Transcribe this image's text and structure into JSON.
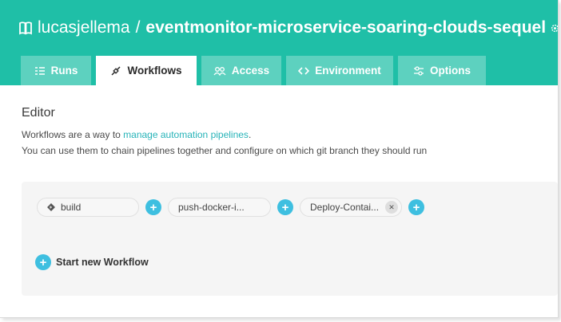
{
  "repo": {
    "owner": "lucasjellema",
    "separator": "/",
    "name": "eventmonitor-microservice-soaring-clouds-sequel"
  },
  "tabs": [
    {
      "label": "Runs",
      "icon": "runs-icon"
    },
    {
      "label": "Workflows",
      "icon": "workflow-icon"
    },
    {
      "label": "Access",
      "icon": "access-icon"
    },
    {
      "label": "Environment",
      "icon": "code-icon"
    },
    {
      "label": "Options",
      "icon": "options-icon"
    }
  ],
  "active_tab": "Workflows",
  "editor": {
    "title": "Editor",
    "desc_prefix": "Workflows are a way to ",
    "desc_link": "manage automation pipelines",
    "desc_suffix": ".",
    "desc_line2": "You can use them to chain pipelines together and configure on which git branch they should run"
  },
  "workflow": {
    "pipelines": [
      "build",
      "push-docker-i...",
      "Deploy-Contai..."
    ],
    "start_label": "Start new Workflow"
  },
  "colors": {
    "header": "#1fbfa7",
    "tab_inactive": "#5dd1bf",
    "link": "#26b3b8",
    "plus": "#3ebfe0"
  }
}
